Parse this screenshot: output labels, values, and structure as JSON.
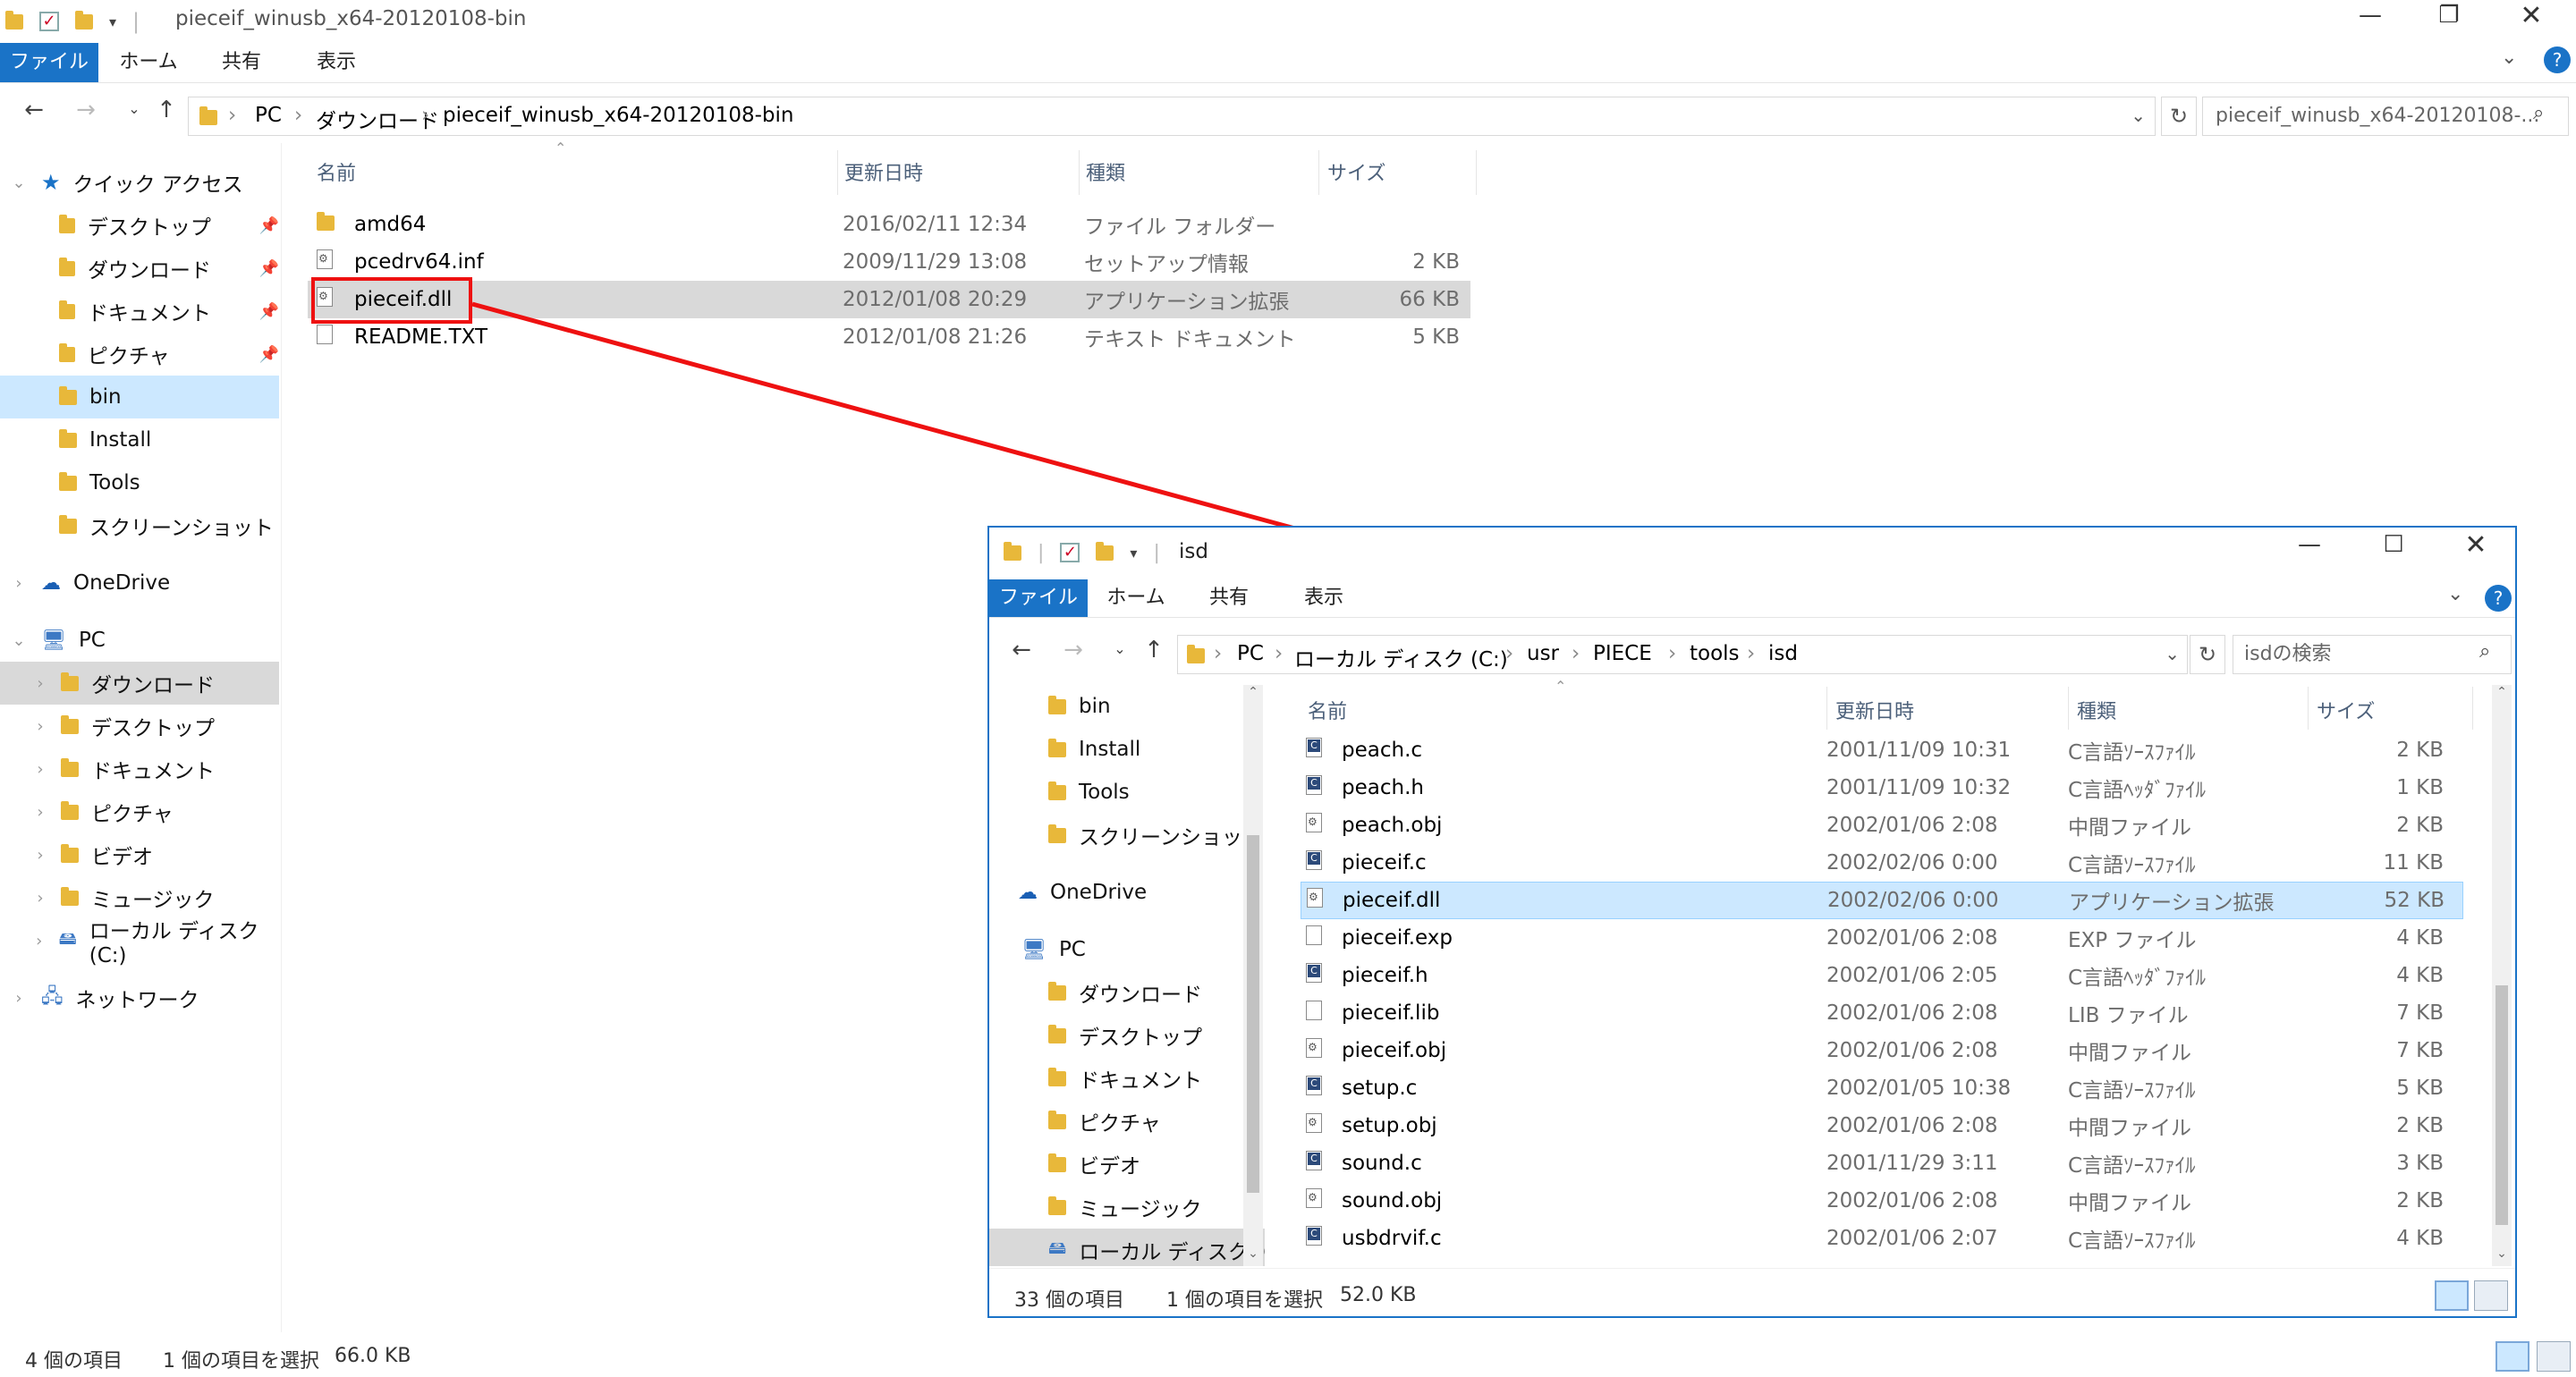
{
  "main_window": {
    "title": "pieceif_winusb_x64-20120108-bin",
    "ribbon_tabs": {
      "file": "ファイル",
      "home": "ホーム",
      "share": "共有",
      "view": "表示"
    },
    "address": {
      "segments": [
        "PC",
        "ダウンロード",
        "pieceif_winusb_x64-20120108-bin"
      ]
    },
    "search_placeholder": "pieceif_winusb_x64-20120108-...",
    "nav_tree": {
      "quick_access": "クイック アクセス",
      "quick_items": [
        {
          "label": "デスクトップ"
        },
        {
          "label": "ダウンロード"
        },
        {
          "label": "ドキュメント"
        },
        {
          "label": "ピクチャ"
        },
        {
          "label": "bin"
        },
        {
          "label": "Install"
        },
        {
          "label": "Tools"
        },
        {
          "label": "スクリーンショット"
        }
      ],
      "onedrive": "OneDrive",
      "pc": "PC",
      "pc_items": [
        {
          "label": "ダウンロード"
        },
        {
          "label": "デスクトップ"
        },
        {
          "label": "ドキュメント"
        },
        {
          "label": "ピクチャ"
        },
        {
          "label": "ビデオ"
        },
        {
          "label": "ミュージック"
        },
        {
          "label": "ローカル ディスク (C:)"
        }
      ],
      "network": "ネットワーク"
    },
    "columns": {
      "name": "名前",
      "date": "更新日時",
      "type": "種類",
      "size": "サイズ"
    },
    "files": [
      {
        "name": "amd64",
        "date": "2016/02/11 12:34",
        "type": "ファイル フォルダー",
        "size": ""
      },
      {
        "name": "pcedrv64.inf",
        "date": "2009/11/29 13:08",
        "type": "セットアップ情報",
        "size": "2 KB"
      },
      {
        "name": "pieceif.dll",
        "date": "2012/01/08 20:29",
        "type": "アプリケーション拡張",
        "size": "66 KB"
      },
      {
        "name": "README.TXT",
        "date": "2012/01/08 21:26",
        "type": "テキスト ドキュメント",
        "size": "5 KB"
      }
    ],
    "status": {
      "count": "4 個の項目",
      "selected": "1 個の項目を選択",
      "size": "66.0 KB"
    }
  },
  "secondary_window": {
    "title": "isd",
    "ribbon_tabs": {
      "file": "ファイル",
      "home": "ホーム",
      "share": "共有",
      "view": "表示"
    },
    "address": {
      "segments": [
        "PC",
        "ローカル ディスク (C:)",
        "usr",
        "PIECE",
        "tools",
        "isd"
      ]
    },
    "search_placeholder": "isdの検索",
    "nav_tree": {
      "quick_items": [
        {
          "label": "bin"
        },
        {
          "label": "Install"
        },
        {
          "label": "Tools"
        },
        {
          "label": "スクリーンショット"
        }
      ],
      "onedrive": "OneDrive",
      "pc": "PC",
      "pc_items": [
        {
          "label": "ダウンロード"
        },
        {
          "label": "デスクトップ"
        },
        {
          "label": "ドキュメント"
        },
        {
          "label": "ピクチャ"
        },
        {
          "label": "ビデオ"
        },
        {
          "label": "ミュージック"
        },
        {
          "label": "ローカル ディスク (C:"
        }
      ]
    },
    "columns": {
      "name": "名前",
      "date": "更新日時",
      "type": "種類",
      "size": "サイズ"
    },
    "files": [
      {
        "name": "peach.c",
        "date": "2001/11/09 10:31",
        "type": "C言語ｿｰｽﾌｧｲﾙ",
        "size": "2 KB",
        "icon": "c"
      },
      {
        "name": "peach.h",
        "date": "2001/11/09 10:32",
        "type": "C言語ﾍｯﾀﾞﾌｧｲﾙ",
        "size": "1 KB",
        "icon": "c"
      },
      {
        "name": "peach.obj",
        "date": "2002/01/06 2:08",
        "type": "中間ファイル",
        "size": "2 KB",
        "icon": "gear"
      },
      {
        "name": "pieceif.c",
        "date": "2002/02/06 0:00",
        "type": "C言語ｿｰｽﾌｧｲﾙ",
        "size": "11 KB",
        "icon": "c"
      },
      {
        "name": "pieceif.dll",
        "date": "2002/02/06 0:00",
        "type": "アプリケーション拡張",
        "size": "52 KB",
        "icon": "gear"
      },
      {
        "name": "pieceif.exp",
        "date": "2002/01/06 2:08",
        "type": "EXP ファイル",
        "size": "4 KB",
        "icon": "blank"
      },
      {
        "name": "pieceif.h",
        "date": "2002/01/06 2:05",
        "type": "C言語ﾍｯﾀﾞﾌｧｲﾙ",
        "size": "4 KB",
        "icon": "c"
      },
      {
        "name": "pieceif.lib",
        "date": "2002/01/06 2:08",
        "type": "LIB ファイル",
        "size": "7 KB",
        "icon": "blank"
      },
      {
        "name": "pieceif.obj",
        "date": "2002/01/06 2:08",
        "type": "中間ファイル",
        "size": "7 KB",
        "icon": "gear"
      },
      {
        "name": "setup.c",
        "date": "2002/01/05 10:38",
        "type": "C言語ｿｰｽﾌｧｲﾙ",
        "size": "5 KB",
        "icon": "c"
      },
      {
        "name": "setup.obj",
        "date": "2002/01/06 2:08",
        "type": "中間ファイル",
        "size": "2 KB",
        "icon": "gear"
      },
      {
        "name": "sound.c",
        "date": "2001/11/29 3:11",
        "type": "C言語ｿｰｽﾌｧｲﾙ",
        "size": "3 KB",
        "icon": "c"
      },
      {
        "name": "sound.obj",
        "date": "2002/01/06 2:08",
        "type": "中間ファイル",
        "size": "2 KB",
        "icon": "gear"
      },
      {
        "name": "usbdrvif.c",
        "date": "2002/01/06 2:07",
        "type": "C言語ｿｰｽﾌｧｲﾙ",
        "size": "4 KB",
        "icon": "c"
      }
    ],
    "status": {
      "count": "33 個の項目",
      "selected": "1 個の項目を選択",
      "size": "52.0 KB"
    }
  },
  "icons": {
    "window_controls": [
      "minimize-icon",
      "maximize-icon",
      "close-icon"
    ],
    "nav": [
      "back-icon",
      "forward-icon",
      "recent-dropdown-icon",
      "up-icon",
      "refresh-icon",
      "search-icon",
      "help-icon"
    ]
  },
  "colors": {
    "accent": "#1a73c7",
    "selection_gray": "#d9d9d9",
    "selection_blue": "#cce8ff",
    "annotation": "#ee1111",
    "folder": "#e8b83a"
  }
}
